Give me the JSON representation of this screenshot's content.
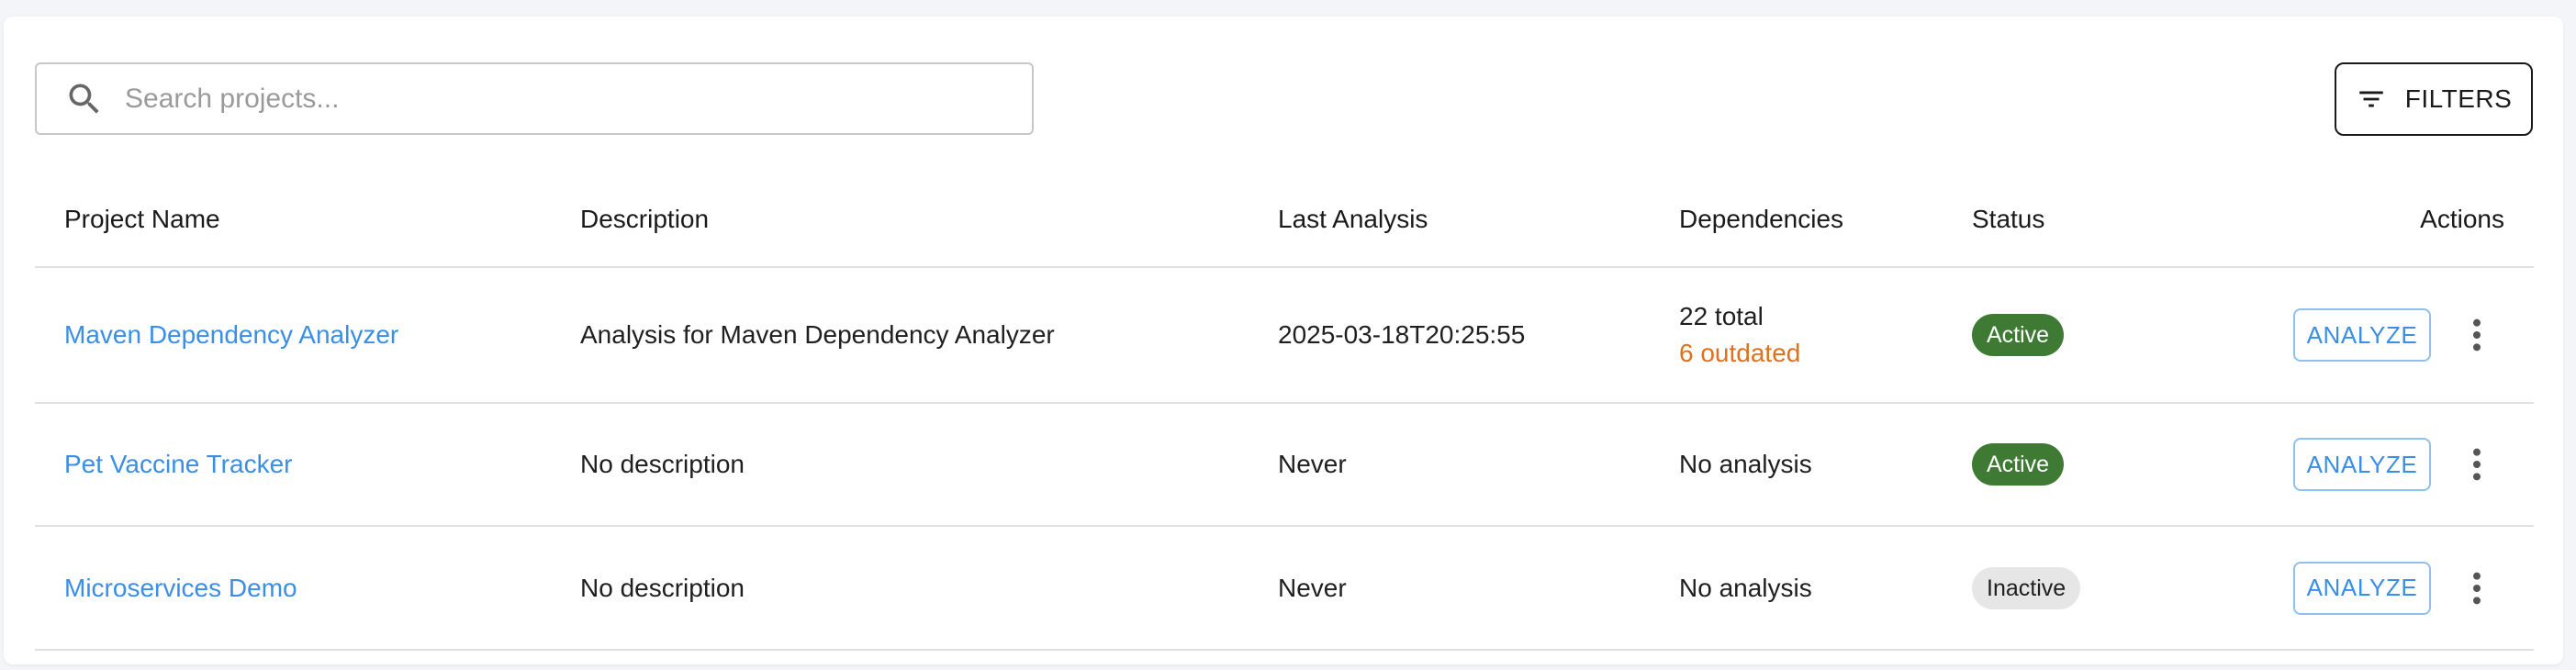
{
  "search": {
    "placeholder": "Search projects...",
    "value": ""
  },
  "toolbar": {
    "filters_label": "FILTERS"
  },
  "table": {
    "headers": {
      "name": "Project Name",
      "description": "Description",
      "last_analysis": "Last Analysis",
      "dependencies": "Dependencies",
      "status": "Status",
      "actions": "Actions"
    },
    "rows": [
      {
        "name": "Maven Dependency Analyzer",
        "description": "Analysis for Maven Dependency Analyzer",
        "last_analysis": "2025-03-18T20:25:55",
        "dependencies_total": "22 total",
        "dependencies_outdated": "6 outdated",
        "status": "Active",
        "analyze_label": "ANALYZE"
      },
      {
        "name": "Pet Vaccine Tracker",
        "description": "No description",
        "last_analysis": "Never",
        "dependencies_text": "No analysis",
        "status": "Active",
        "analyze_label": "ANALYZE"
      },
      {
        "name": "Microservices Demo",
        "description": "No description",
        "last_analysis": "Never",
        "dependencies_text": "No analysis",
        "status": "Inactive",
        "analyze_label": "ANALYZE"
      }
    ]
  },
  "colors": {
    "link": "#3a8ee6",
    "active_badge": "#3f7a34",
    "inactive_badge": "#e6e6e6",
    "outdated": "#e0711a"
  },
  "icons": {
    "search": "search-icon",
    "filters": "filter-list-icon",
    "more": "more-vertical-icon"
  }
}
